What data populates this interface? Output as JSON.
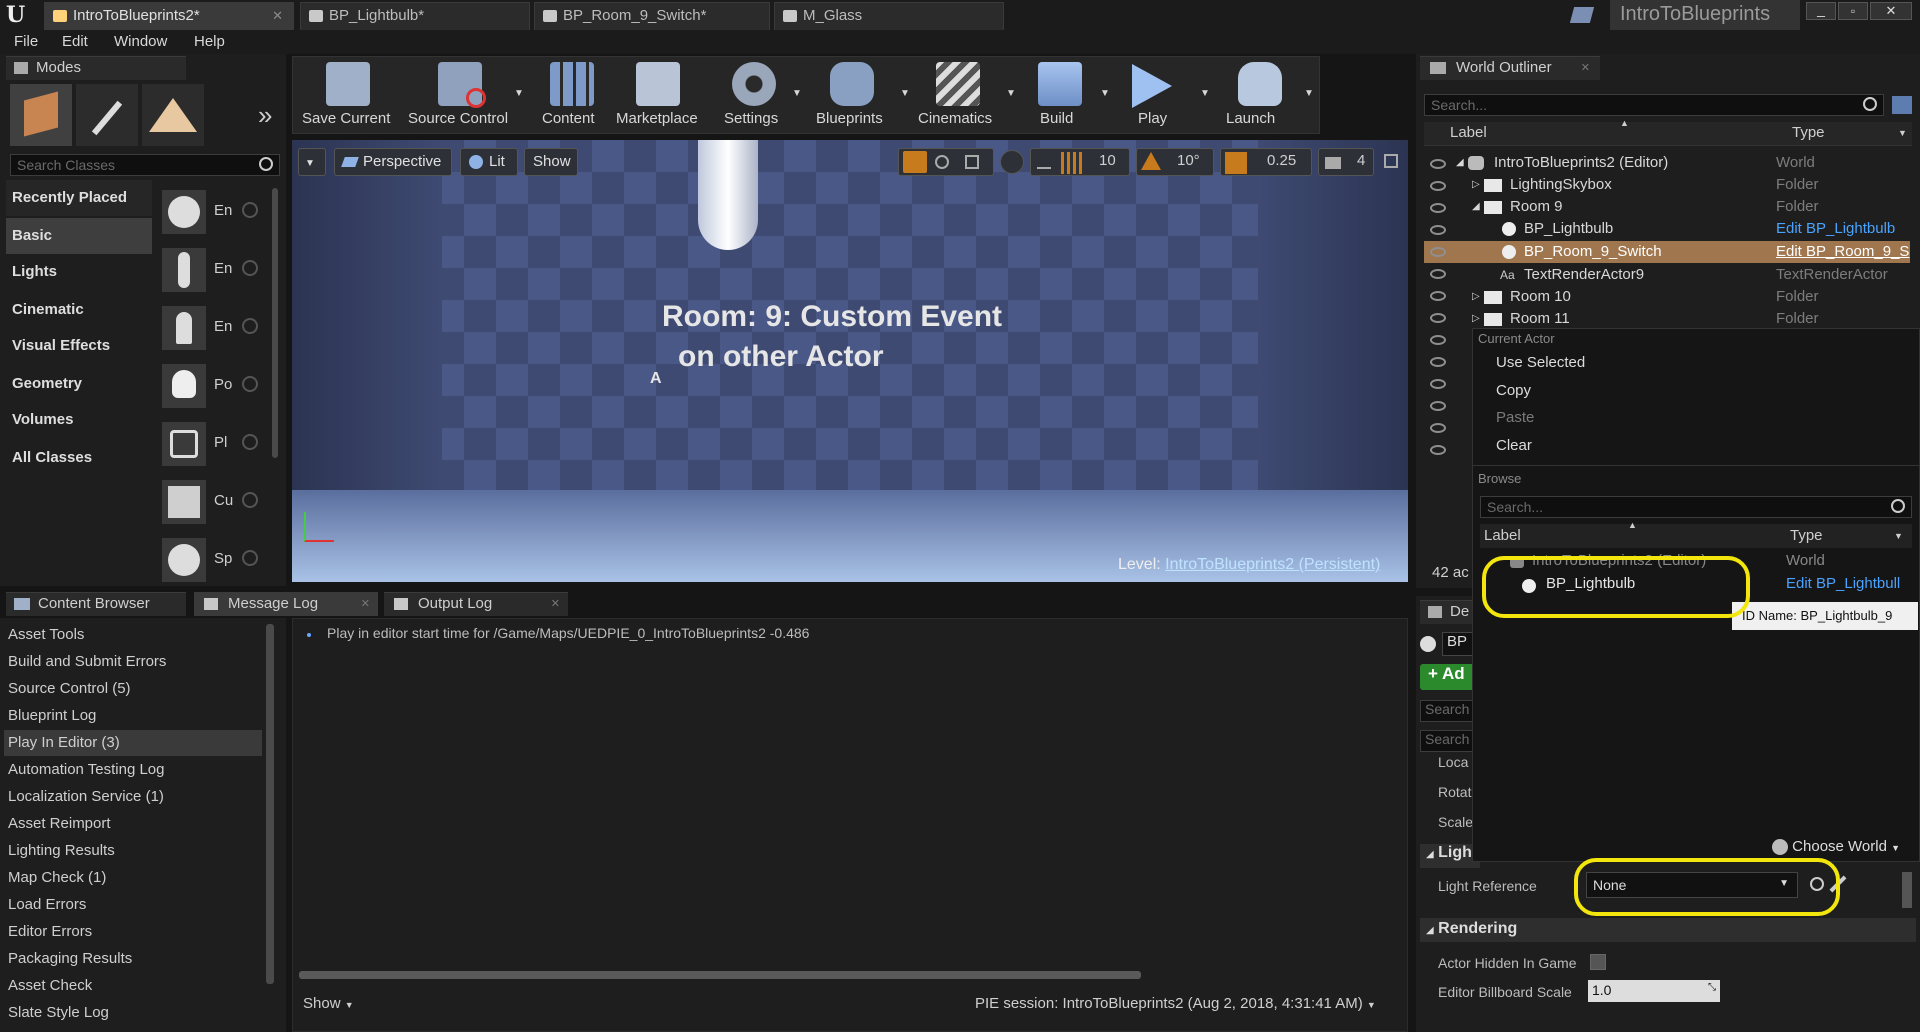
{
  "title_tabs": [
    {
      "label": "IntroToBlueprints2*",
      "active": true
    },
    {
      "label": "BP_Lightbulb*"
    },
    {
      "label": "BP_Room_9_Switch*"
    },
    {
      "label": "M_Glass"
    }
  ],
  "project_title": "IntroToBlueprints",
  "menu": [
    "File",
    "Edit",
    "Window",
    "Help"
  ],
  "modes": {
    "title": "Modes",
    "search_placeholder": "Search Classes",
    "categories": [
      "Recently Placed",
      "Basic",
      "Lights",
      "Cinematic",
      "Visual Effects",
      "Geometry",
      "Volumes",
      "All Classes"
    ],
    "items": [
      "En",
      "En",
      "En",
      "Po",
      "Pl",
      "Cu",
      "Sp"
    ]
  },
  "toolbar": [
    "Save Current",
    "Source Control",
    "Content",
    "Marketplace",
    "Settings",
    "Blueprints",
    "Cinematics",
    "Build",
    "Play",
    "Launch"
  ],
  "viewport": {
    "perspective": "Perspective",
    "lit": "Lit",
    "show": "Show",
    "grid": "10",
    "rot": "10°",
    "scale": "0.25",
    "speed": "4",
    "text_line1": "Room: 9: Custom Event",
    "text_line2": "on other Actor",
    "marker": "A",
    "level_label": "Level:",
    "level_name": "IntroToBlueprints2 (Persistent)"
  },
  "bottom_tabs": [
    "Content Browser",
    "Message Log",
    "Output Log"
  ],
  "log_categories": [
    "Asset Tools",
    "Build and Submit Errors",
    "Source Control (5)",
    "Blueprint Log",
    "Play In Editor (3)",
    "Automation Testing Log",
    "Localization Service (1)",
    "Asset Reimport",
    "Lighting Results",
    "Map Check (1)",
    "Load Errors",
    "Editor Errors",
    "Packaging Results",
    "Asset Check",
    "Slate Style Log"
  ],
  "log_message": "Play in editor start time for /Game/Maps/UEDPIE_0_IntroToBlueprints2 -0.486",
  "log_show": "Show",
  "pie_session": "PIE session: IntroToBlueprints2 (Aug 2, 2018, 4:31:41 AM)",
  "outliner": {
    "title": "World Outliner",
    "search_placeholder": "Search...",
    "col_label": "Label",
    "col_type": "Type",
    "rows": [
      {
        "label": "IntroToBlueprints2 (Editor)",
        "type": "World"
      },
      {
        "label": "LightingSkybox",
        "type": "Folder"
      },
      {
        "label": "Room 9",
        "type": "Folder"
      },
      {
        "label": "BP_Lightbulb",
        "type": "Edit BP_Lightbulb"
      },
      {
        "label": "BP_Room_9_Switch",
        "type": "Edit BP_Room_9_S"
      },
      {
        "label": "TextRenderActor9",
        "type": "TextRenderActor"
      },
      {
        "label": "Room 10",
        "type": "Folder"
      },
      {
        "label": "Room 11",
        "type": "Folder"
      }
    ],
    "actor_count": "42 ac"
  },
  "picker": {
    "current_actor": "Current Actor",
    "use_selected": "Use Selected",
    "copy": "Copy",
    "paste": "Paste",
    "clear": "Clear",
    "browse": "Browse",
    "search_placeholder": "Search...",
    "col_label": "Label",
    "col_type": "Type",
    "row_world": "IntroToBlueprints2 (Editor)",
    "row_world_type": "World",
    "row_item": "BP_Lightbulb",
    "row_item_type": "Edit BP_Lightbull",
    "tooltip": "ID Name: BP_Lightbulb_9",
    "choose_world": "Choose World"
  },
  "details": {
    "tab": "De",
    "actor": "BP",
    "add": "+ Ad",
    "search1": "Search",
    "search2": "Search",
    "loc": "Loca",
    "rot": "Rotat",
    "scale": "Scale",
    "section_light": "Light",
    "light_ref_label": "Light Reference",
    "light_ref_value": "None",
    "section_rendering": "Rendering",
    "hidden_label": "Actor Hidden In Game",
    "billboard_label": "Editor Billboard Scale",
    "billboard_value": "1.0"
  },
  "colors": {
    "accent": "#f2e60c",
    "selection": "#a0764e",
    "link": "#4aa3ff"
  }
}
